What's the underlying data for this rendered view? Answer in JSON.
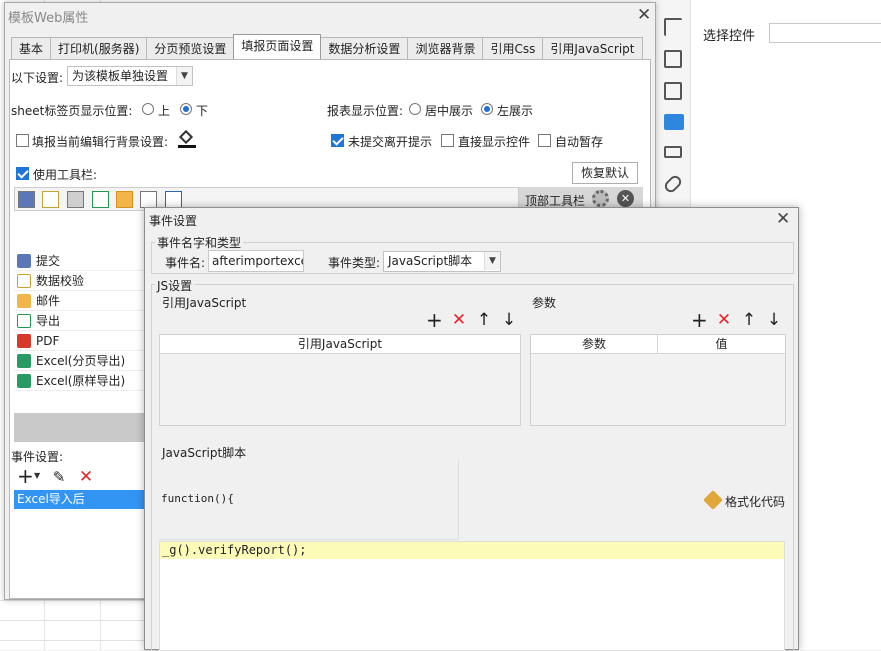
{
  "win1": {
    "title": "模板Web属性",
    "tabs": [
      "基本",
      "打印机(服务器)",
      "分页预览设置",
      "填报页面设置",
      "数据分析设置",
      "浏览器背景",
      "引用Css",
      "引用JavaScript"
    ],
    "active_tab": 3,
    "setting_label": "以下设置:",
    "setting_value": "为该模板单独设置",
    "sheet_pos_label": "sheet标签页显示位置:",
    "sheet_pos_options": [
      "上",
      "下"
    ],
    "report_pos_label": "报表显示位置:",
    "report_pos_options": [
      "居中展示",
      "左展示"
    ],
    "chk_bg": "填报当前编辑行背景设置:",
    "chk_leave": "未提交离开提示",
    "chk_direct": "直接显示控件",
    "chk_autosave": "自动暂存",
    "chk_toolbar": "使用工具栏:",
    "restore_btn": "恢复默认",
    "top_toolbar": "顶部工具栏",
    "tree_items": [
      "提交",
      "数据校验",
      "邮件",
      "导出",
      "PDF",
      "Excel(分页导出)",
      "Excel(原样导出)"
    ],
    "events_label": "事件设置:",
    "event_selected": "Excel导入后"
  },
  "right_panel": {
    "label": "选择控件",
    "input_value": ""
  },
  "win2": {
    "title": "事件设置",
    "group1_title": "事件名字和类型",
    "event_name_label": "事件名:",
    "event_name_value": "afterimportexcel",
    "event_type_label": "事件类型:",
    "event_type_value": "JavaScript脚本",
    "group2_title": "JS设置",
    "ref_js_label": "引用JavaScript",
    "ref_js_header": "引用JavaScript",
    "params_label": "参数",
    "params_header_1": "参数",
    "params_header_2": "值",
    "script_label": "JavaScript脚本",
    "function_sig": "function(){",
    "format_btn": "格式化代码",
    "code_line": "_g().verifyReport();"
  },
  "colors": {
    "accent": "#1e76d6",
    "selection": "#3295f3",
    "red_icon": "#e3262c",
    "code_highlight": "#fdfbb8"
  },
  "icons": [
    "close-icon",
    "add-icon",
    "delete-icon",
    "up-arrow-icon",
    "down-arrow-icon",
    "edit-icon",
    "paint-bucket-icon",
    "gear-icon",
    "broom-icon"
  ]
}
